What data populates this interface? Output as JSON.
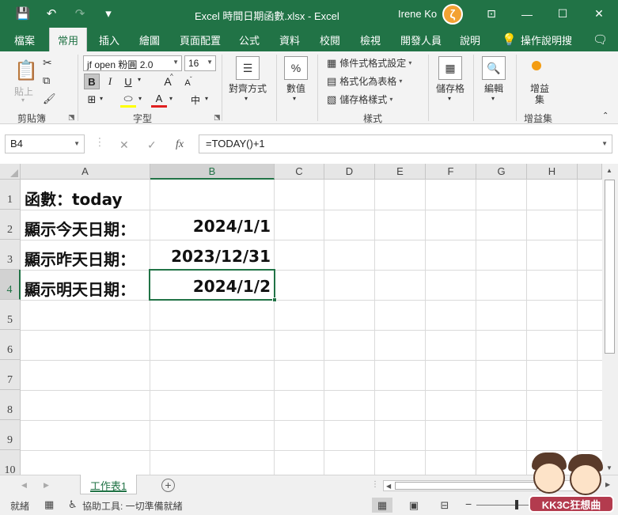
{
  "window": {
    "title": "Excel 時間日期函數.xlsx  -  Excel",
    "user": "Irene Ko",
    "avatar_initial": "ζ",
    "icons": [
      "save-icon",
      "undo-icon",
      "redo-icon",
      "customize-qat-icon",
      "ribbon-display-icon",
      "minimize-icon",
      "maximize-icon",
      "close-icon"
    ],
    "glyphs": {
      "save": "💾",
      "undo": "↶",
      "redo": "↷",
      "qat": "▾",
      "ribbon": "⊡",
      "min": "—",
      "max": "☐",
      "close": "✕"
    }
  },
  "ribbon_tabs": [
    "檔案",
    "常用",
    "插入",
    "繪圖",
    "頁面配置",
    "公式",
    "資料",
    "校閱",
    "檢視",
    "開發人員",
    "說明",
    "操作說明搜"
  ],
  "ribbon_tabs_active": "常用",
  "ribbon": {
    "clipboard": {
      "paste": "貼上",
      "group": "剪貼簿"
    },
    "font": {
      "name": "jf open 粉圓 2.0",
      "size": "16",
      "bold": "B",
      "italic": "I",
      "underline": "U",
      "grow": "A",
      "shrink": "A",
      "phonetic": "中",
      "group": "字型"
    },
    "alignment": {
      "label": "對齊方式"
    },
    "number": {
      "icon_text": "%",
      "label": "數值"
    },
    "styles": {
      "conditional": "條件式格式設定",
      "table": "格式化為表格",
      "cell": "儲存格樣式",
      "group": "樣式"
    },
    "cells": {
      "label": "儲存格"
    },
    "editing": {
      "label": "編輯"
    },
    "addins": {
      "label": "增益集",
      "group": "增益集"
    }
  },
  "formula_bar": {
    "name_box": "B4",
    "formula": "=TODAY()+1",
    "cancel": "✕",
    "enter": "✓",
    "fx": "fx"
  },
  "columns": [
    "A",
    "B",
    "C",
    "D",
    "E",
    "F",
    "G",
    "H"
  ],
  "selected_column": "B",
  "rows": [
    "1",
    "2",
    "3",
    "4",
    "5",
    "6",
    "7",
    "8",
    "9",
    "10"
  ],
  "selected_row": "4",
  "cells": {
    "A1": "函數：today",
    "A2": "顯示今天日期：",
    "B2": "2024/1/1",
    "A3": "顯示昨天日期：",
    "B3": "2023/12/31",
    "A4": "顯示明天日期：",
    "B4": "2024/1/2"
  },
  "sheet_tabs": {
    "active": "工作表1",
    "add": "+"
  },
  "status_bar": {
    "ready": "就緒",
    "accessibility": "協助工具: 一切準備就緒"
  },
  "watermark": "KK3C狂想曲",
  "colors": {
    "accent": "#217346",
    "avatar": "#f3a233"
  }
}
